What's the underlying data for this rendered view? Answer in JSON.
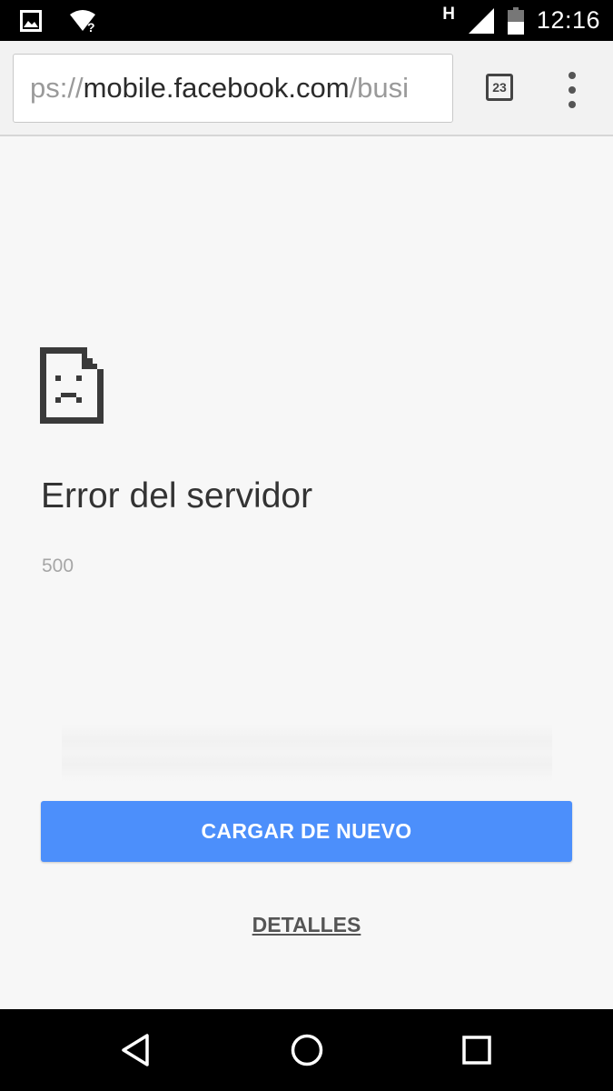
{
  "status_bar": {
    "network_type": "H",
    "clock": "12:16",
    "icons": [
      "image-notification-icon",
      "wifi-unknown-icon",
      "cellular-signal-icon",
      "battery-icon"
    ]
  },
  "toolbar": {
    "url_scheme": "ps://",
    "url_host": "mobile.facebook.com",
    "url_path": "/busi",
    "tab_count": "23",
    "icons": [
      "tab-switcher-icon",
      "overflow-menu-icon"
    ]
  },
  "error": {
    "icon": "sad-document-icon",
    "title": "Error del servidor",
    "code": "500",
    "reload_label": "CARGAR DE NUEVO",
    "details_label": "DETALLES",
    "accent_color": "#4c8ffb"
  },
  "nav_bar": {
    "icons": [
      "back-icon",
      "home-icon",
      "recents-icon"
    ]
  }
}
